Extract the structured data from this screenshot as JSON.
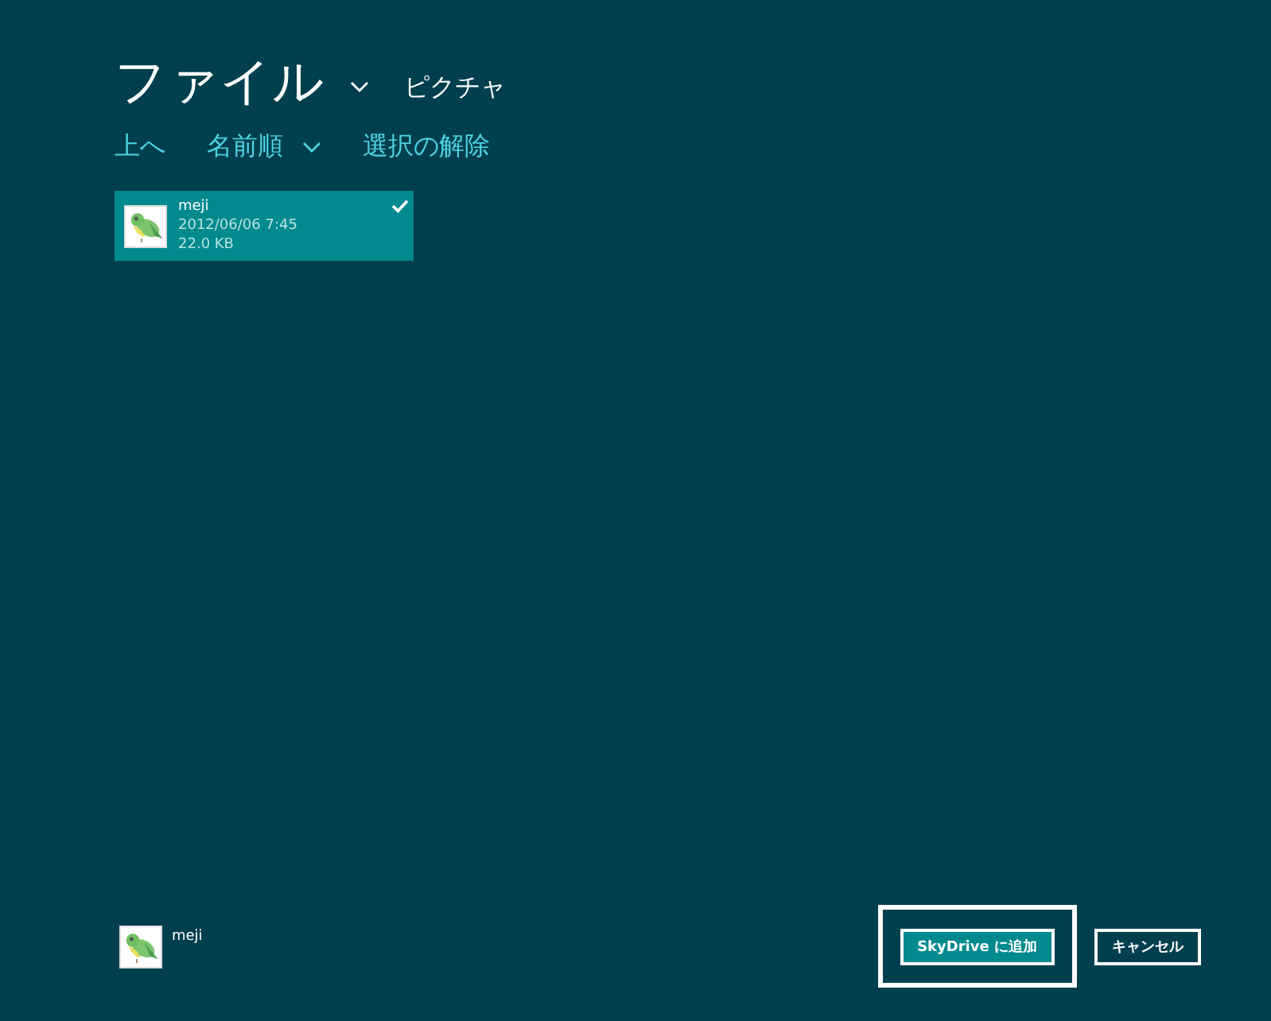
{
  "header": {
    "title": "ファイル",
    "location": "ピクチャ"
  },
  "commands": [
    {
      "kind": "link",
      "label": "上へ"
    },
    {
      "kind": "dropdown",
      "label": "名前順"
    },
    {
      "kind": "link",
      "label": "選択の解除"
    }
  ],
  "files": [
    {
      "name": "meji",
      "date": "2012/06/06 7:45",
      "size": "22.0 KB",
      "selected": true
    }
  ],
  "basket": [
    {
      "name": "meji"
    }
  ],
  "buttons": [
    {
      "label": "SkyDrive に追加",
      "kind": "primary",
      "focused": true
    },
    {
      "label": "キャンセル",
      "kind": "secondary",
      "focused": false
    }
  ]
}
